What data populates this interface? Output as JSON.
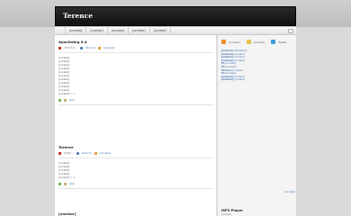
{
  "site": {
    "title": "Terence"
  },
  "nav": {
    "items": [
      "[unclear]",
      "[unclear]",
      "[unclear]",
      "[unclear]",
      "[unclear]"
    ]
  },
  "posts": [
    {
      "title": "ApacSwing 0.4",
      "date": "2017/12/...",
      "author": "Terence",
      "comments": "[unclear]",
      "body": [
        "[unclear]",
        "[unclear]",
        "[unclear]",
        "[unclear]",
        "[unclear]",
        "[unclear]",
        "[unclear]",
        "[unclear]",
        "[unclear]",
        "[unclear]",
        "[unclear]"
      ],
      "read_more": "[...]",
      "tags": [
        "Java"
      ]
    },
    {
      "title": "Terence",
      "date": "2016/...",
      "author": "Terence",
      "comments": "[unclear]",
      "body": [
        "[unclear]",
        "[unclear]",
        "[unclear]",
        "[unclear]",
        "[unclear]"
      ],
      "read_more": "[...]",
      "tags": [
        "Java"
      ]
    },
    {
      "title": "[unclear]"
    }
  ],
  "sidebar": {
    "icons": {
      "rss": "rss-icon",
      "mail": "mail-icon",
      "twitter": "twitter-icon"
    },
    "labels": [
      "[unclear]",
      "[unclear]",
      "Twitter"
    ],
    "items": [
      {
        "who": "[unclear]",
        "text": "ApacSwing"
      },
      {
        "who": "[unclear]",
        "text": "[unclear]"
      },
      {
        "who": "[unclear]",
        "text": "[unclear]"
      },
      {
        "who": "[unclear]",
        "text": "[unclear]"
      },
      {
        "who": "Pe",
        "text": "[unclear]"
      },
      {
        "who": "Pe",
        "text": "[unclear]"
      },
      {
        "who": "Terence",
        "text": "[unclear]"
      },
      {
        "who": "Pe",
        "text": "[unclear]"
      },
      {
        "who": "[unclear]",
        "text": "[unclear]"
      },
      {
        "who": "[unclear]",
        "text": "[unclear]"
      }
    ],
    "more": "[unclear]",
    "mp3": {
      "title": "MP3 Player",
      "desc": "[unclear]"
    }
  }
}
